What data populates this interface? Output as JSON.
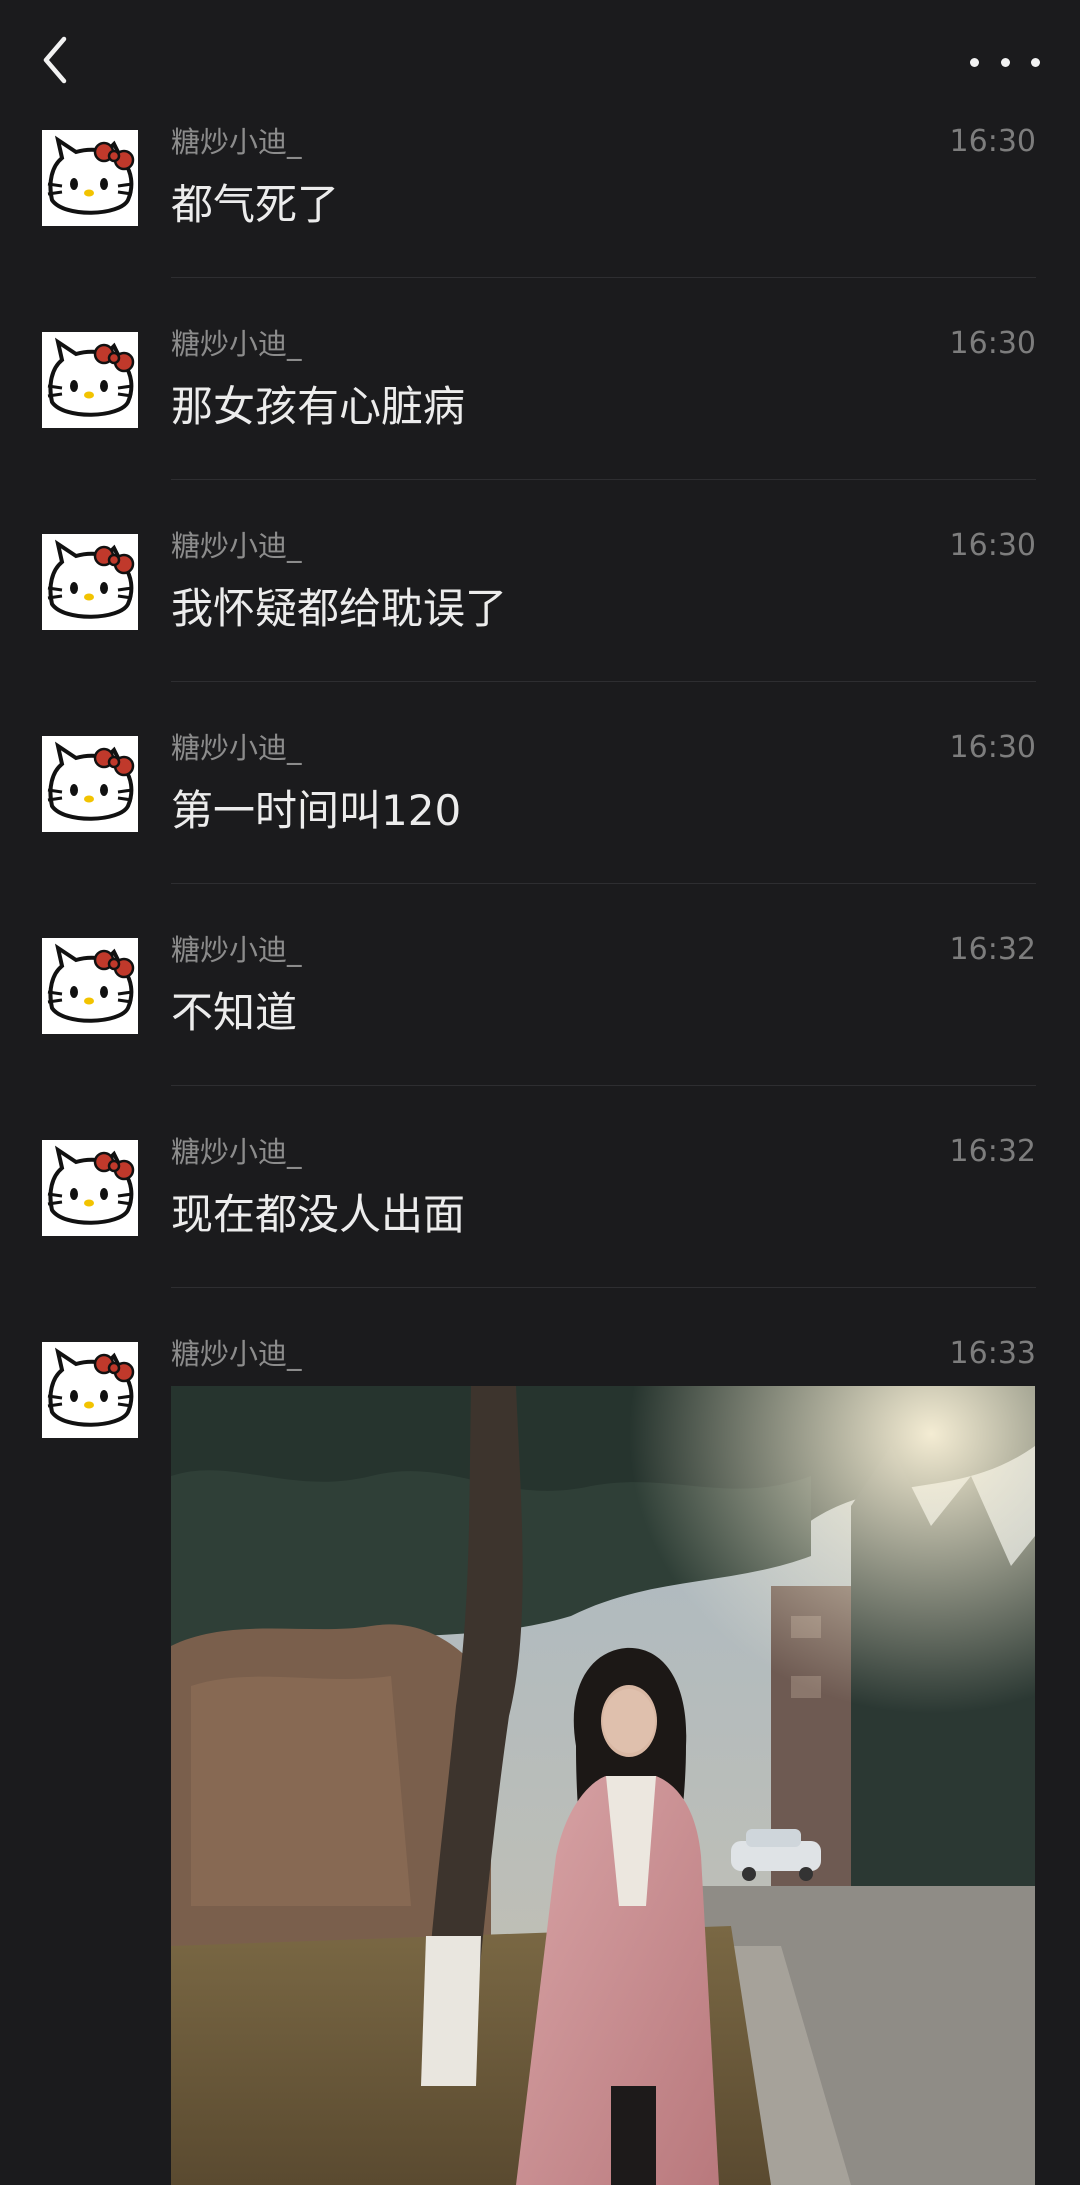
{
  "header": {
    "back_icon": "chevron-left-icon",
    "more_icon": "more-horizontal-icon"
  },
  "messages": [
    {
      "sender": "糖炒小迪_",
      "time": "16:30",
      "text": "都气死了"
    },
    {
      "sender": "糖炒小迪_",
      "time": "16:30",
      "text": "那女孩有心脏病"
    },
    {
      "sender": "糖炒小迪_",
      "time": "16:30",
      "text": "我怀疑都给耽误了"
    },
    {
      "sender": "糖炒小迪_",
      "time": "16:30",
      "text": "第一时间叫120"
    },
    {
      "sender": "糖炒小迪_",
      "time": "16:32",
      "text": "不知道"
    },
    {
      "sender": "糖炒小迪_",
      "time": "16:32",
      "text": "现在都没人出面"
    },
    {
      "sender": "糖炒小迪_",
      "time": "16:33"
    }
  ],
  "colors": {
    "background": "#1b1b1d",
    "text_primary": "#ececec",
    "text_secondary": "#8c8c8c",
    "divider": "#2e2e31",
    "avatar_bow": "#c0392b"
  }
}
